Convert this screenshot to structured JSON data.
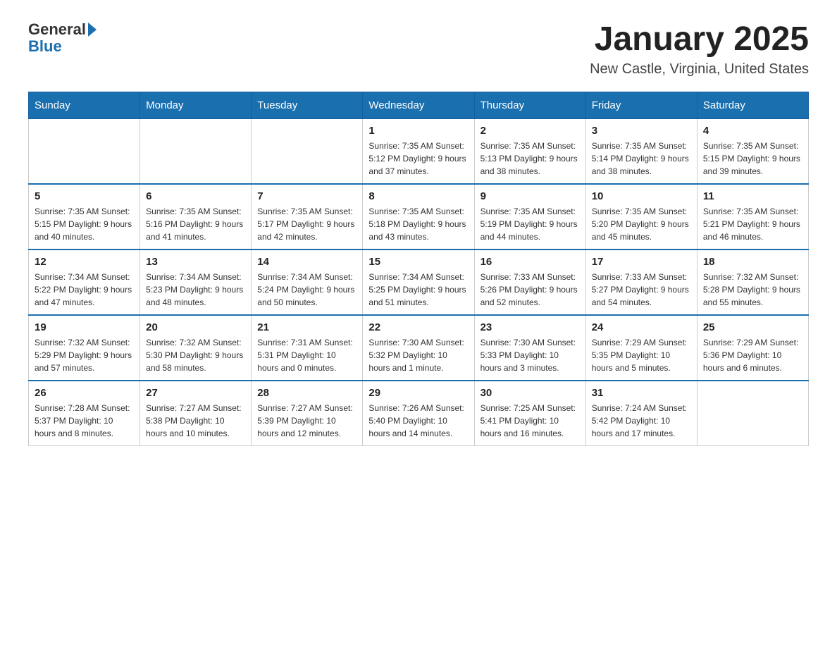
{
  "header": {
    "logo": {
      "general": "General",
      "arrow": "▶",
      "blue": "Blue"
    },
    "title": "January 2025",
    "subtitle": "New Castle, Virginia, United States"
  },
  "calendar": {
    "weekdays": [
      "Sunday",
      "Monday",
      "Tuesday",
      "Wednesday",
      "Thursday",
      "Friday",
      "Saturday"
    ],
    "weeks": [
      [
        {
          "day": "",
          "info": ""
        },
        {
          "day": "",
          "info": ""
        },
        {
          "day": "",
          "info": ""
        },
        {
          "day": "1",
          "info": "Sunrise: 7:35 AM\nSunset: 5:12 PM\nDaylight: 9 hours and 37 minutes."
        },
        {
          "day": "2",
          "info": "Sunrise: 7:35 AM\nSunset: 5:13 PM\nDaylight: 9 hours and 38 minutes."
        },
        {
          "day": "3",
          "info": "Sunrise: 7:35 AM\nSunset: 5:14 PM\nDaylight: 9 hours and 38 minutes."
        },
        {
          "day": "4",
          "info": "Sunrise: 7:35 AM\nSunset: 5:15 PM\nDaylight: 9 hours and 39 minutes."
        }
      ],
      [
        {
          "day": "5",
          "info": "Sunrise: 7:35 AM\nSunset: 5:15 PM\nDaylight: 9 hours and 40 minutes."
        },
        {
          "day": "6",
          "info": "Sunrise: 7:35 AM\nSunset: 5:16 PM\nDaylight: 9 hours and 41 minutes."
        },
        {
          "day": "7",
          "info": "Sunrise: 7:35 AM\nSunset: 5:17 PM\nDaylight: 9 hours and 42 minutes."
        },
        {
          "day": "8",
          "info": "Sunrise: 7:35 AM\nSunset: 5:18 PM\nDaylight: 9 hours and 43 minutes."
        },
        {
          "day": "9",
          "info": "Sunrise: 7:35 AM\nSunset: 5:19 PM\nDaylight: 9 hours and 44 minutes."
        },
        {
          "day": "10",
          "info": "Sunrise: 7:35 AM\nSunset: 5:20 PM\nDaylight: 9 hours and 45 minutes."
        },
        {
          "day": "11",
          "info": "Sunrise: 7:35 AM\nSunset: 5:21 PM\nDaylight: 9 hours and 46 minutes."
        }
      ],
      [
        {
          "day": "12",
          "info": "Sunrise: 7:34 AM\nSunset: 5:22 PM\nDaylight: 9 hours and 47 minutes."
        },
        {
          "day": "13",
          "info": "Sunrise: 7:34 AM\nSunset: 5:23 PM\nDaylight: 9 hours and 48 minutes."
        },
        {
          "day": "14",
          "info": "Sunrise: 7:34 AM\nSunset: 5:24 PM\nDaylight: 9 hours and 50 minutes."
        },
        {
          "day": "15",
          "info": "Sunrise: 7:34 AM\nSunset: 5:25 PM\nDaylight: 9 hours and 51 minutes."
        },
        {
          "day": "16",
          "info": "Sunrise: 7:33 AM\nSunset: 5:26 PM\nDaylight: 9 hours and 52 minutes."
        },
        {
          "day": "17",
          "info": "Sunrise: 7:33 AM\nSunset: 5:27 PM\nDaylight: 9 hours and 54 minutes."
        },
        {
          "day": "18",
          "info": "Sunrise: 7:32 AM\nSunset: 5:28 PM\nDaylight: 9 hours and 55 minutes."
        }
      ],
      [
        {
          "day": "19",
          "info": "Sunrise: 7:32 AM\nSunset: 5:29 PM\nDaylight: 9 hours and 57 minutes."
        },
        {
          "day": "20",
          "info": "Sunrise: 7:32 AM\nSunset: 5:30 PM\nDaylight: 9 hours and 58 minutes."
        },
        {
          "day": "21",
          "info": "Sunrise: 7:31 AM\nSunset: 5:31 PM\nDaylight: 10 hours and 0 minutes."
        },
        {
          "day": "22",
          "info": "Sunrise: 7:30 AM\nSunset: 5:32 PM\nDaylight: 10 hours and 1 minute."
        },
        {
          "day": "23",
          "info": "Sunrise: 7:30 AM\nSunset: 5:33 PM\nDaylight: 10 hours and 3 minutes."
        },
        {
          "day": "24",
          "info": "Sunrise: 7:29 AM\nSunset: 5:35 PM\nDaylight: 10 hours and 5 minutes."
        },
        {
          "day": "25",
          "info": "Sunrise: 7:29 AM\nSunset: 5:36 PM\nDaylight: 10 hours and 6 minutes."
        }
      ],
      [
        {
          "day": "26",
          "info": "Sunrise: 7:28 AM\nSunset: 5:37 PM\nDaylight: 10 hours and 8 minutes."
        },
        {
          "day": "27",
          "info": "Sunrise: 7:27 AM\nSunset: 5:38 PM\nDaylight: 10 hours and 10 minutes."
        },
        {
          "day": "28",
          "info": "Sunrise: 7:27 AM\nSunset: 5:39 PM\nDaylight: 10 hours and 12 minutes."
        },
        {
          "day": "29",
          "info": "Sunrise: 7:26 AM\nSunset: 5:40 PM\nDaylight: 10 hours and 14 minutes."
        },
        {
          "day": "30",
          "info": "Sunrise: 7:25 AM\nSunset: 5:41 PM\nDaylight: 10 hours and 16 minutes."
        },
        {
          "day": "31",
          "info": "Sunrise: 7:24 AM\nSunset: 5:42 PM\nDaylight: 10 hours and 17 minutes."
        },
        {
          "day": "",
          "info": ""
        }
      ]
    ]
  }
}
